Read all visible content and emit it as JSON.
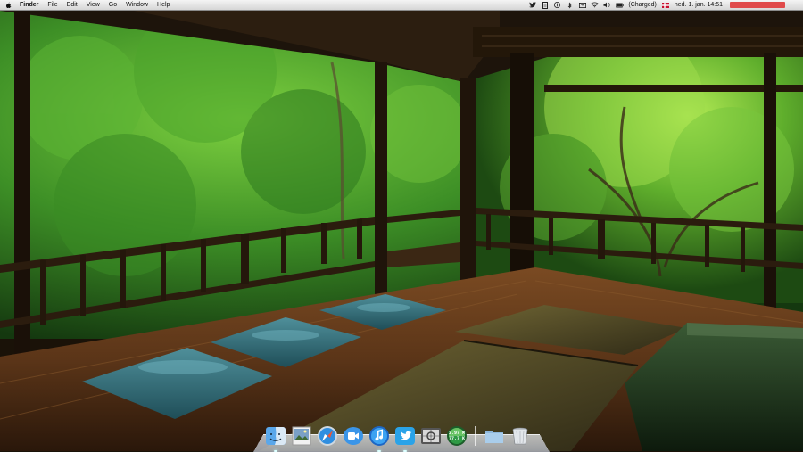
{
  "menubar": {
    "app_name": "Finder",
    "menus": [
      "File",
      "Edit",
      "View",
      "Go",
      "Window",
      "Help"
    ],
    "battery_status": "(Charged)",
    "clock": "ned. 1. jan.  14:51"
  },
  "dock": {
    "items": [
      {
        "name": "Finder",
        "icon": "finder-icon"
      },
      {
        "name": "Preview",
        "icon": "preview-icon"
      },
      {
        "name": "Safari",
        "icon": "safari-icon"
      },
      {
        "name": "FaceTime",
        "icon": "facetime-icon"
      },
      {
        "name": "iTunes",
        "icon": "itunes-icon"
      },
      {
        "name": "Twitter",
        "icon": "twitter-icon"
      },
      {
        "name": "Screenshot",
        "icon": "screenshot-icon"
      },
      {
        "name": "Network Meter",
        "icon": "network-meter-icon"
      },
      {
        "name": "Applications Folder",
        "icon": "folder-icon"
      },
      {
        "name": "Trash",
        "icon": "trash-icon"
      }
    ],
    "network_meter": {
      "down": "2.97 M",
      "up": "77.7 K"
    }
  },
  "colors": {
    "menu_accent": "#e04a4a",
    "cushion": "#2f6b78",
    "foliage": "#3f9a2a"
  }
}
